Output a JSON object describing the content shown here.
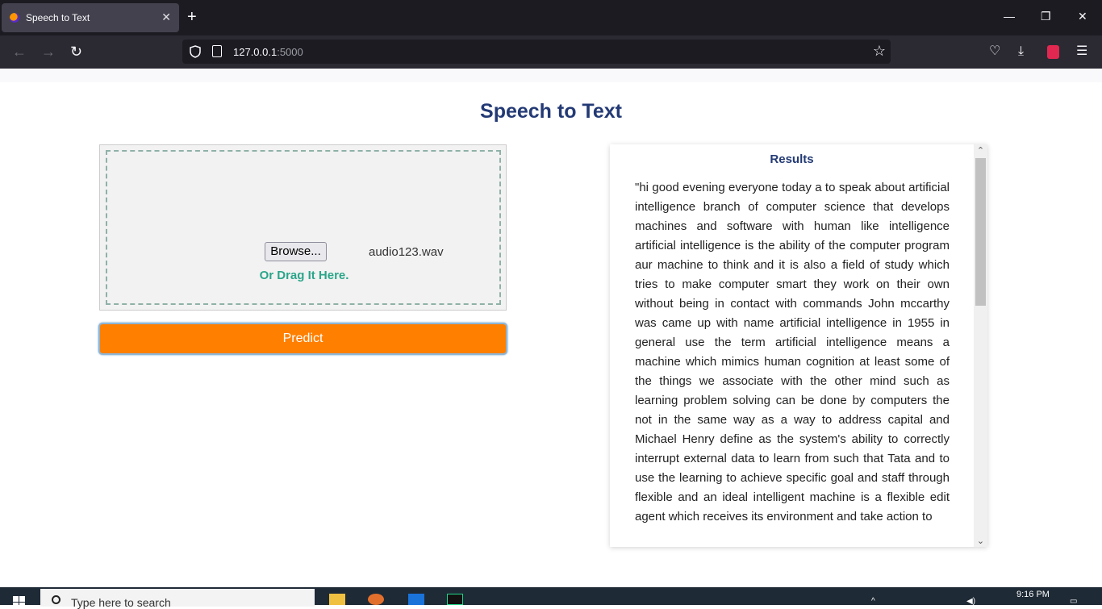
{
  "browser": {
    "tab_title": "Speech to Text",
    "url_host": "127.0.0.1",
    "url_port": ":5000"
  },
  "page": {
    "title": "Speech to Text",
    "upload": {
      "browse_label": "Browse...",
      "file_name": "audio123.wav",
      "drag_text": "Or Drag It Here."
    },
    "predict_label": "Predict",
    "results": {
      "heading": "Results",
      "text": "\"hi good evening everyone today a to speak about artificial intelligence branch of computer science that develops machines and software with human like intelligence artificial intelligence is the ability of the computer program aur machine to think and it is also a field of study which tries to make computer smart they work on their own without being in contact with commands John mccarthy was came up with name artificial intelligence in 1955 in general use the term artificial intelligence means a machine which mimics human cognition at least some of the things we associate with the other mind such as learning problem solving can be done by computers the not in the same way as a way to address capital and Michael Henry define as the system's ability to correctly interrupt external data to learn from such that Tata and to use the learning to achieve specific goal and staff through flexible and an ideal intelligent machine is a flexible edit agent which receives its environment and take action to"
    }
  },
  "taskbar": {
    "search_placeholder": "Type here to search",
    "time": "9:16 PM"
  },
  "colors": {
    "title": "#233a75",
    "accent_orange": "#ff7f00",
    "drag_green": "#2aa58a"
  }
}
